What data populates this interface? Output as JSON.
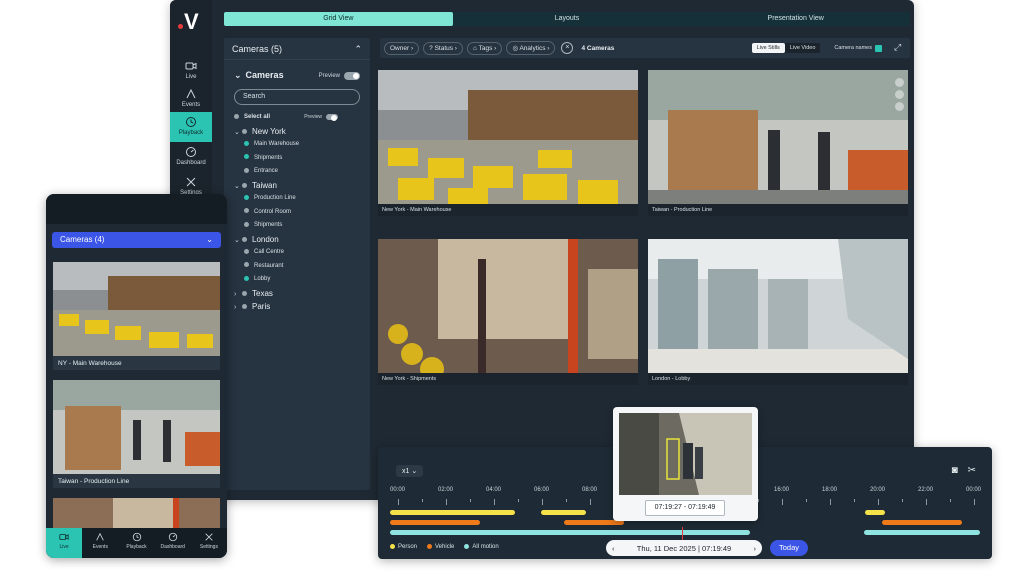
{
  "desktop": {
    "rail": [
      {
        "label": "Live",
        "icon": "video-icon"
      },
      {
        "label": "Events",
        "icon": "events-icon"
      },
      {
        "label": "Playback",
        "icon": "playback-icon",
        "active": true
      },
      {
        "label": "Dashboard",
        "icon": "dashboard-icon"
      },
      {
        "label": "Settings",
        "icon": "settings-icon"
      }
    ],
    "tabs": [
      "Grid View",
      "Layouts",
      "Presentation View"
    ],
    "tree": {
      "title": "Cameras",
      "count": "(5)",
      "subtitle": "Cameras",
      "preview_label": "Preview",
      "search_placeholder": "Search",
      "select_all": "Select all",
      "select_all_preview": "Preview",
      "groups": [
        {
          "name": "New York",
          "items": [
            "Main Warehouse",
            "Shipments",
            "Entrance"
          ]
        },
        {
          "name": "Taiwan",
          "items": [
            "Production Line",
            "Control Room",
            "Shipments"
          ]
        },
        {
          "name": "London",
          "items": [
            "Call Centre",
            "Restaurant",
            "Lobby"
          ]
        },
        {
          "name": "Texas",
          "items": []
        },
        {
          "name": "Paris",
          "items": []
        }
      ]
    },
    "filters": {
      "owner": "Owner",
      "status": "Status",
      "tags": "Tags",
      "analytics": "Analytics",
      "close": "×",
      "cameras": "4 Cameras",
      "live_stills": "Live Stills",
      "live_video": "Live Video",
      "camera_names": "Camera names"
    },
    "tiles": [
      {
        "caption": "New York - Main Warehouse"
      },
      {
        "caption": "Taiwan - Production Line"
      },
      {
        "caption": "New York - Shipments"
      },
      {
        "caption": "London - Lobby"
      }
    ]
  },
  "timeline": {
    "speed": "x1",
    "ticks": [
      "00:00",
      "02:00",
      "04:00",
      "06:00",
      "08:00",
      "16:00",
      "18:00",
      "20:00",
      "22:00",
      "00:00"
    ],
    "popup_time": "07:19:27 - 07:19:49",
    "date": "Thu, 11 Dec 2025 | 07:19:49",
    "today": "Today",
    "legend": [
      {
        "label": "Person",
        "color": "#f5e14a"
      },
      {
        "label": "Vehicle",
        "color": "#f07a1a"
      },
      {
        "label": "All motion",
        "color": "#8fe3e0"
      }
    ]
  },
  "mobile": {
    "dropdown": "Cameras (4)",
    "tiles": [
      {
        "caption": "NY - Main Warehouse"
      },
      {
        "caption": "Taiwan - Production Line"
      }
    ],
    "nav": [
      {
        "label": "Live",
        "active": true
      },
      {
        "label": "Events"
      },
      {
        "label": "Playback"
      },
      {
        "label": "Dashboard"
      },
      {
        "label": "Settings"
      }
    ]
  },
  "colors": {
    "accent": "#2bc4b3",
    "brand_blue": "#3b55e6",
    "bg": "#1f2933"
  }
}
